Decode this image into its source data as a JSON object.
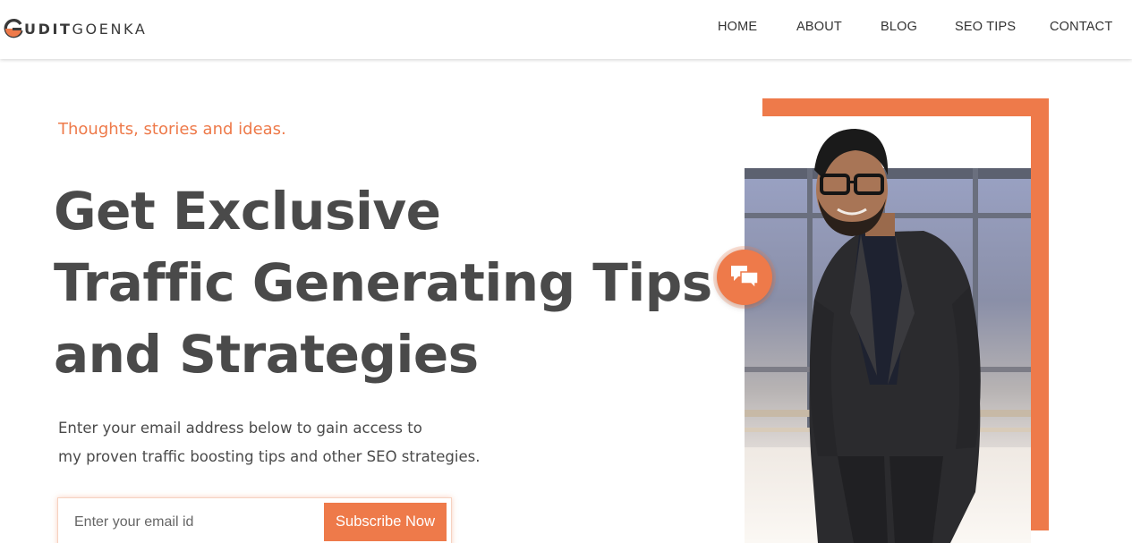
{
  "brand": {
    "logo_bold": "UDIT",
    "logo_light": "GOENKA",
    "accent_color": "#ee7a4a",
    "text_color": "#4a4a4a"
  },
  "nav": {
    "items": [
      {
        "label": "HOME"
      },
      {
        "label": "ABOUT"
      },
      {
        "label": "BLOG"
      },
      {
        "label": "SEO TIPS"
      },
      {
        "label": "CONTACT"
      }
    ]
  },
  "hero": {
    "tagline": "Thoughts, stories and ideas.",
    "headline_lines": [
      "Get Exclusive",
      "Traffic Generating Tips",
      "and Strategies"
    ],
    "description_lines": [
      "Enter your email address below to gain access to",
      "my proven traffic boosting tips and other SEO strategies."
    ],
    "email_placeholder": "Enter your email id",
    "subscribe_label": "Subscribe Now"
  },
  "icons": {
    "chat": "chat-bubbles-icon",
    "logo": "logo-g-mark-icon"
  }
}
